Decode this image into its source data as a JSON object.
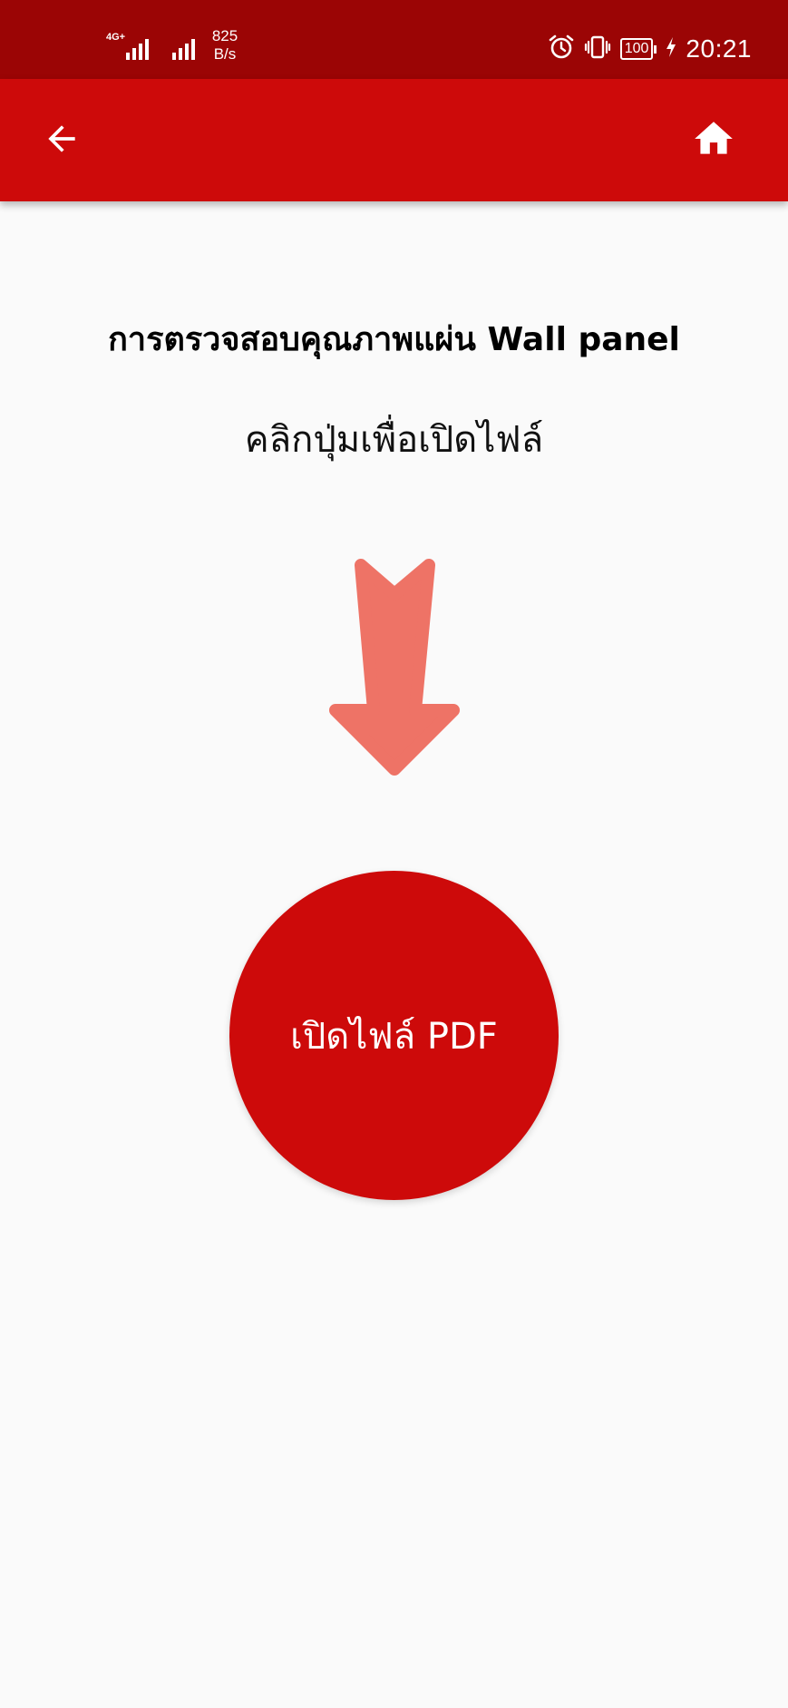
{
  "status_bar": {
    "network_type": "4G+",
    "network_speed_value": "825",
    "network_speed_unit": "B/s",
    "battery_level": "100",
    "time": "20:21"
  },
  "app_bar": {
    "back_icon": "arrow-left-icon",
    "home_icon": "home-icon",
    "color": "#cd0a0a"
  },
  "content": {
    "title": "การตรวจสอบคุณภาพแผ่น Wall panel",
    "instruction": "คลิกปุ่มเพื่อเปิดไฟล์",
    "arrow_icon": "arrow-down-icon",
    "arrow_color": "#ee7366"
  },
  "button": {
    "label": "เปิดไฟล์ PDF",
    "color": "#cd0a0a"
  }
}
